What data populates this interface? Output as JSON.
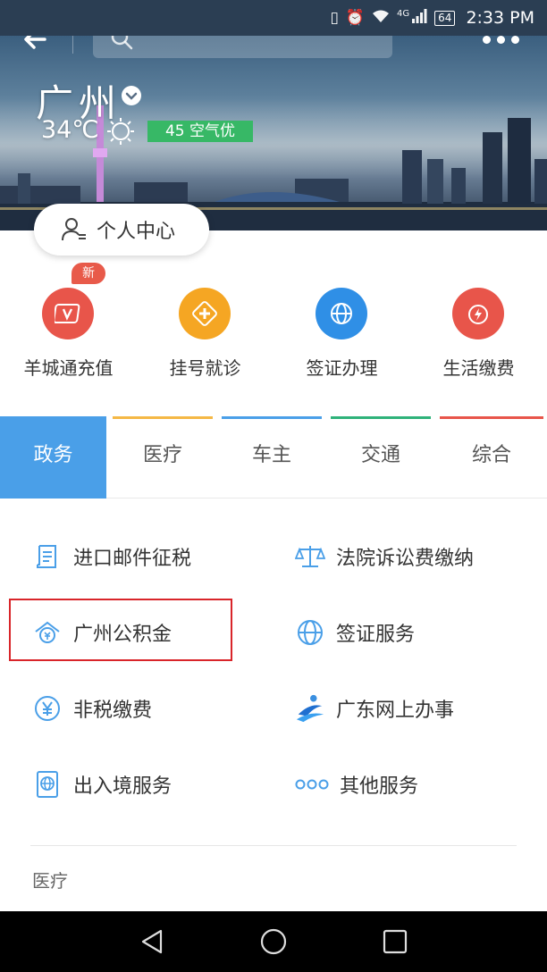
{
  "status_bar": {
    "network": "4G",
    "battery": "64",
    "time": "2:33 PM"
  },
  "header": {
    "city": "广州",
    "temperature": "34℃",
    "air_quality": "45 空气优"
  },
  "personal_center": {
    "label": "个人中心"
  },
  "quick_services": [
    {
      "label": "羊城通充值",
      "icon": "card-v-icon",
      "color": "#e8554a",
      "badge": "新"
    },
    {
      "label": "挂号就诊",
      "icon": "medical-cross-icon",
      "color": "#f5a623"
    },
    {
      "label": "签证办理",
      "icon": "globe-icon",
      "color": "#2f8fe6"
    },
    {
      "label": "生活缴费",
      "icon": "bolt-icon",
      "color": "#e8554a"
    }
  ],
  "tabs": [
    {
      "label": "政务",
      "active": true,
      "color": "#4a9fe8"
    },
    {
      "label": "医疗",
      "color": "#f5b845"
    },
    {
      "label": "车主",
      "color": "#4a9fe8"
    },
    {
      "label": "交通",
      "color": "#2fb27a"
    },
    {
      "label": "综合",
      "color": "#e8554a"
    }
  ],
  "services": [
    {
      "label": "进口邮件征税",
      "icon": "document-icon"
    },
    {
      "label": "法院诉讼费缴纳",
      "icon": "scales-icon"
    },
    {
      "label": "广州公积金",
      "icon": "fund-house-icon"
    },
    {
      "label": "签证服务",
      "icon": "globe-icon"
    },
    {
      "label": "非税缴费",
      "icon": "yuan-icon"
    },
    {
      "label": "广东网上办事",
      "icon": "guangdong-logo-icon"
    },
    {
      "label": "出入境服务",
      "icon": "passport-icon"
    },
    {
      "label": "其他服务",
      "icon": "more-dots-icon"
    }
  ],
  "next_section": {
    "title": "医疗"
  },
  "accent_color": "#4a9fe8",
  "highlight_color": "#d9252a"
}
